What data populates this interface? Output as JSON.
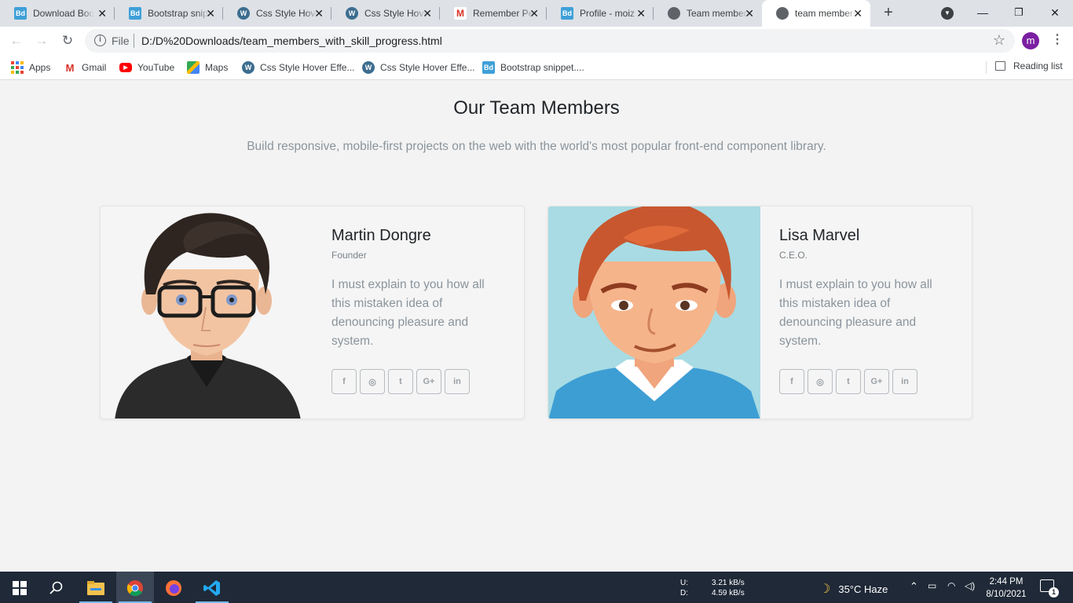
{
  "browser": {
    "tabs": [
      {
        "title": "Download Bootstrap",
        "favicon": "bd"
      },
      {
        "title": "Bootstrap snippet",
        "favicon": "bd"
      },
      {
        "title": "Css Style Hover Effects",
        "favicon": "wp"
      },
      {
        "title": "Css Style Hover Effects",
        "favicon": "wp"
      },
      {
        "title": "Remember Pe",
        "favicon": "gmail"
      },
      {
        "title": "Profile - moiz",
        "favicon": "bd"
      },
      {
        "title": "Team members",
        "favicon": "globe"
      },
      {
        "title": "team members",
        "favicon": "globe",
        "active": true
      }
    ],
    "address": {
      "scheme_label": "File",
      "url": "D:/D%20Downloads/team_members_with_skill_progress.html"
    },
    "profile_initial": "m",
    "bookmarks": [
      {
        "label": "Apps",
        "icon": "apps-icon"
      },
      {
        "label": "Gmail",
        "icon": "gmail-icon"
      },
      {
        "label": "YouTube",
        "icon": "youtube-icon"
      },
      {
        "label": "Maps",
        "icon": "maps-icon"
      },
      {
        "label": "Css Style Hover Effe...",
        "icon": "wordpress-icon"
      },
      {
        "label": "Css Style Hover Effe...",
        "icon": "wordpress-icon"
      },
      {
        "label": "Bootstrap snippet....",
        "icon": "bootstrap-icon"
      }
    ],
    "reading_list": "Reading list"
  },
  "page": {
    "title": "Our Team Members",
    "subtitle": "Build responsive, mobile-first projects on the web with the world's most popular front-end component library.",
    "members": [
      {
        "name": "Martin Dongre",
        "role": "Founder",
        "bio": "I must explain to you how all this mistaken idea of denouncing pleasure and system.",
        "photo_bg": "#f5f5f5"
      },
      {
        "name": "Lisa Marvel",
        "role": "C.E.O.",
        "bio": "I must explain to you how all this mistaken idea of denouncing pleasure and system.",
        "photo_bg": "#a8dbe3"
      }
    ],
    "social_icons": [
      "facebook-icon",
      "instagram-icon",
      "twitter-icon",
      "google-plus-icon",
      "linkedin-icon"
    ]
  },
  "taskbar": {
    "net_labels": [
      "U:",
      "D:"
    ],
    "net_values": [
      "3.21 kB/s",
      "4.59 kB/s"
    ],
    "weather": "35°C  Haze",
    "time": "2:44 PM",
    "date": "8/10/2021",
    "notifications": "1"
  }
}
